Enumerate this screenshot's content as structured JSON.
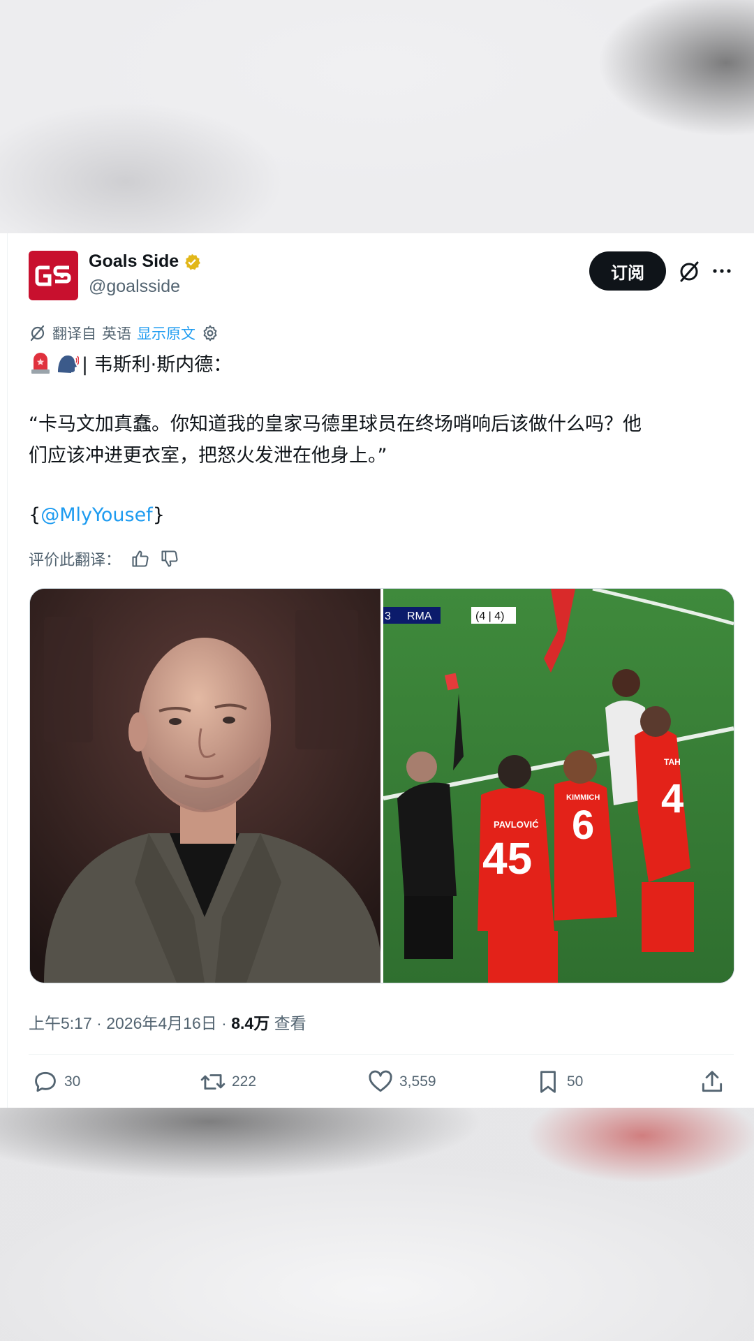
{
  "author": {
    "name": "Goals Side",
    "handle": "@goalsside",
    "logo_text": "GS"
  },
  "actions_top": {
    "subscribe_label": "订阅"
  },
  "translation": {
    "prefix": "翻译自",
    "language": "英语",
    "show_original": "显示原文"
  },
  "tweet": {
    "line1": "| 韦斯利·斯内德：",
    "line2": "“卡马文加真蠢。你知道我的皇家马德里球员在终场哨响后该做什么吗？他",
    "line3": "们应该冲进更衣室，把怒火发泄在他身上。”",
    "mention_open": "{",
    "mention": "@MlyYousef",
    "mention_close": "}"
  },
  "rate": {
    "label": "评价此翻译："
  },
  "media": {
    "scoreboard_num": "3",
    "scoreboard_team": "RMA",
    "scoreboard_agg": "(4 | 4)",
    "jersey_45_name": "PAVLOVIĆ",
    "jersey_45_num": "45",
    "jersey_6_name": "KIMMICH",
    "jersey_6_num": "6",
    "jersey_4_name": "TAH",
    "jersey_4_num": "4"
  },
  "meta": {
    "time": "上午5:17",
    "date": "2026年4月16日",
    "views": "8.4万",
    "views_label": "查看",
    "sep": "·"
  },
  "stats": {
    "replies": "30",
    "retweets": "222",
    "likes": "3,559",
    "bookmarks": "50"
  },
  "colors": {
    "accent": "#1d9bf0",
    "brand": "#c8102e",
    "verified": "#e2b719"
  }
}
